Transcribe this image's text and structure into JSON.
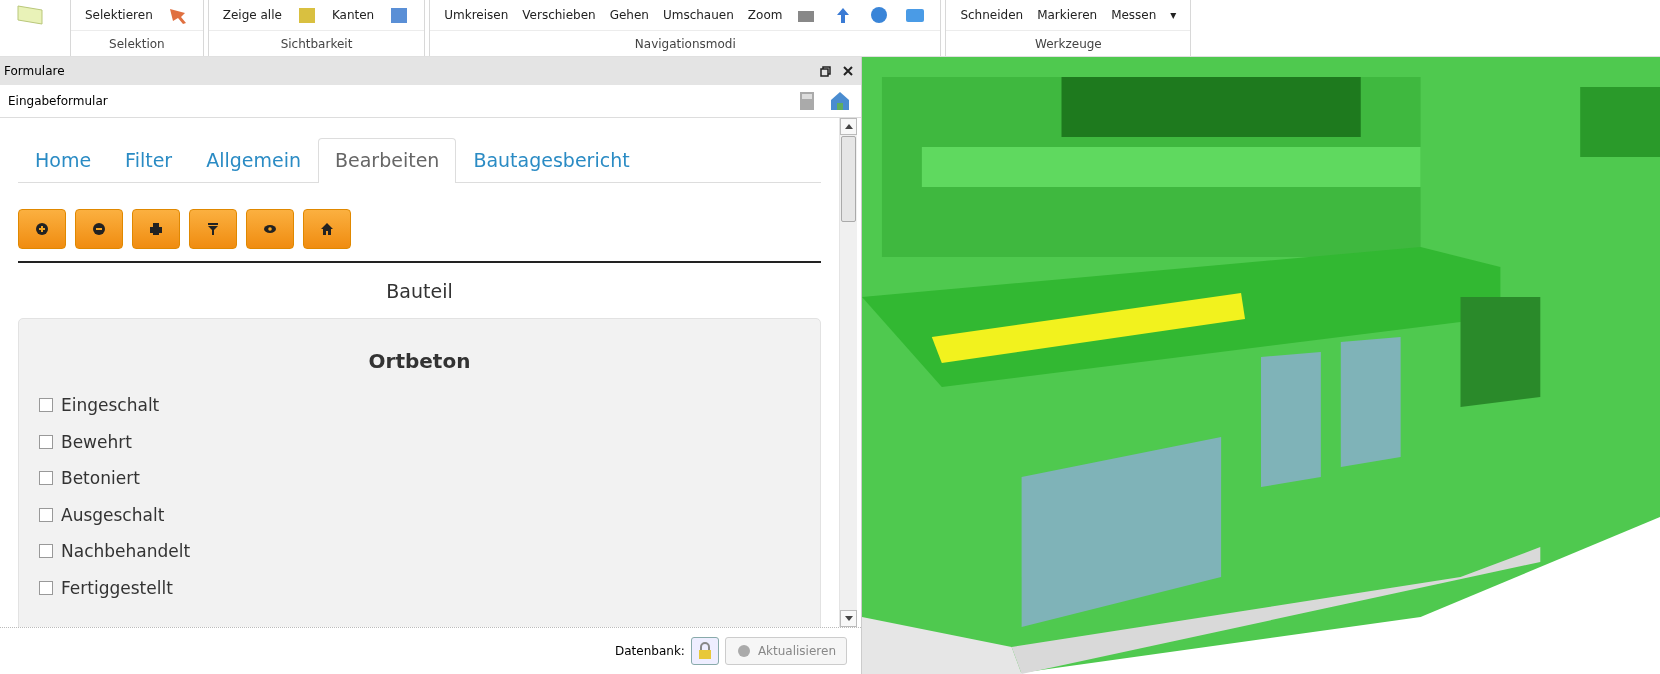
{
  "ribbon": {
    "groups": [
      {
        "label": "Selektion",
        "items": [
          "Selektieren"
        ]
      },
      {
        "label": "Sichtbarkeit",
        "items": [
          "Zeige alle",
          "Kanten"
        ]
      },
      {
        "label": "Navigationsmodi",
        "items": [
          "Umkreisen",
          "Verschieben",
          "Gehen",
          "Umschauen",
          "Zoom"
        ]
      },
      {
        "label": "Werkzeuge",
        "items": [
          "Schneiden",
          "Markieren",
          "Messen"
        ],
        "dropdown": "▾"
      }
    ]
  },
  "panel": {
    "title": "Formulare",
    "subtitle": "Eingabeformular"
  },
  "tabs": [
    {
      "label": "Home",
      "selected": false
    },
    {
      "label": "Filter",
      "selected": false
    },
    {
      "label": "Allgemein",
      "selected": false
    },
    {
      "label": "Bearbeiten",
      "selected": true
    },
    {
      "label": "Bautagesbericht",
      "selected": false
    }
  ],
  "section_title": "Bauteil",
  "card": {
    "title": "Ortbeton",
    "checkboxes": [
      {
        "label": "Eingeschalt",
        "checked": false
      },
      {
        "label": "Bewehrt",
        "checked": false
      },
      {
        "label": "Betoniert",
        "checked": false
      },
      {
        "label": "Ausgeschalt",
        "checked": false
      },
      {
        "label": "Nachbehandelt",
        "checked": false
      },
      {
        "label": "Fertiggestellt",
        "checked": false
      }
    ]
  },
  "footer": {
    "label": "Datenbank:",
    "button": "Aktualisieren"
  }
}
